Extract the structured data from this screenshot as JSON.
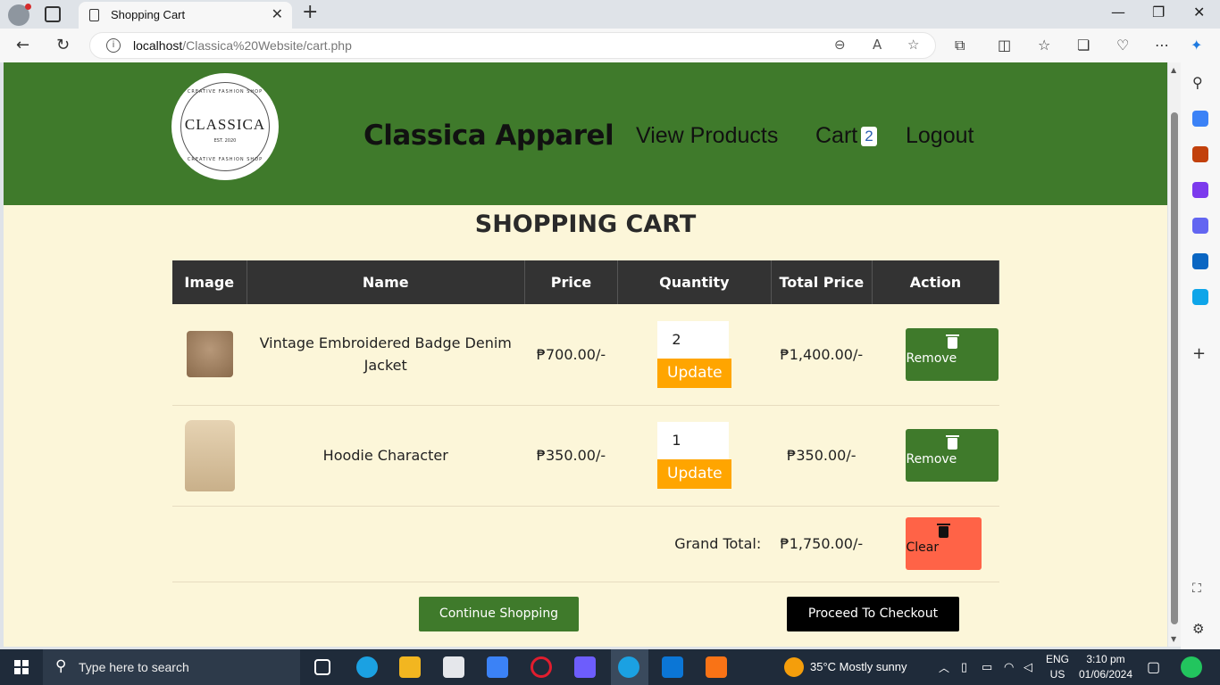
{
  "browser": {
    "tab_title": "Shopping Cart",
    "url_host": "localhost",
    "url_path": "/Classica%20Website/cart.php"
  },
  "header": {
    "logo": {
      "name": "CLASSICA",
      "est": "EST. 2020",
      "arc_text_top": "CREATIVE FASHION SHOP",
      "arc_text_bottom": "CREATIVE FASHION SHOP"
    },
    "brand": "Classica Apparel",
    "nav": {
      "view_products": "View Products",
      "cart": "Cart",
      "cart_count": "2",
      "logout": "Logout"
    }
  },
  "page_title": "SHOPPING CART",
  "table": {
    "headers": [
      "Image",
      "Name",
      "Price",
      "Quantity",
      "Total Price",
      "Action"
    ],
    "rows": [
      {
        "name": "Vintage Embroidered Badge Denim Jacket",
        "price": "₱700.00/-",
        "quantity": "2",
        "total": "₱1,400.00/-",
        "update": "Update",
        "remove": "Remove",
        "image": "jacket"
      },
      {
        "name": "Hoodie Character",
        "price": "₱350.00/-",
        "quantity": "1",
        "total": "₱350.00/-",
        "update": "Update",
        "remove": "Remove",
        "image": "hoodie"
      }
    ],
    "grand_total_label": "Grand Total:",
    "grand_total": "₱1,750.00/-",
    "clear": "Clear"
  },
  "actions": {
    "continue": "Continue Shopping",
    "checkout": "Proceed To Checkout"
  },
  "taskbar": {
    "search_placeholder": "Type here to search",
    "weather": "35°C  Mostly sunny",
    "lang_top": "ENG",
    "lang_bottom": "US",
    "time": "3:10 pm",
    "date": "01/06/2024"
  },
  "colors": {
    "header_green": "#3f7a2b",
    "page_bg": "#fcf6d9",
    "table_header": "#333333",
    "update_orange": "#ffa500",
    "clear_red": "#ff6347"
  }
}
